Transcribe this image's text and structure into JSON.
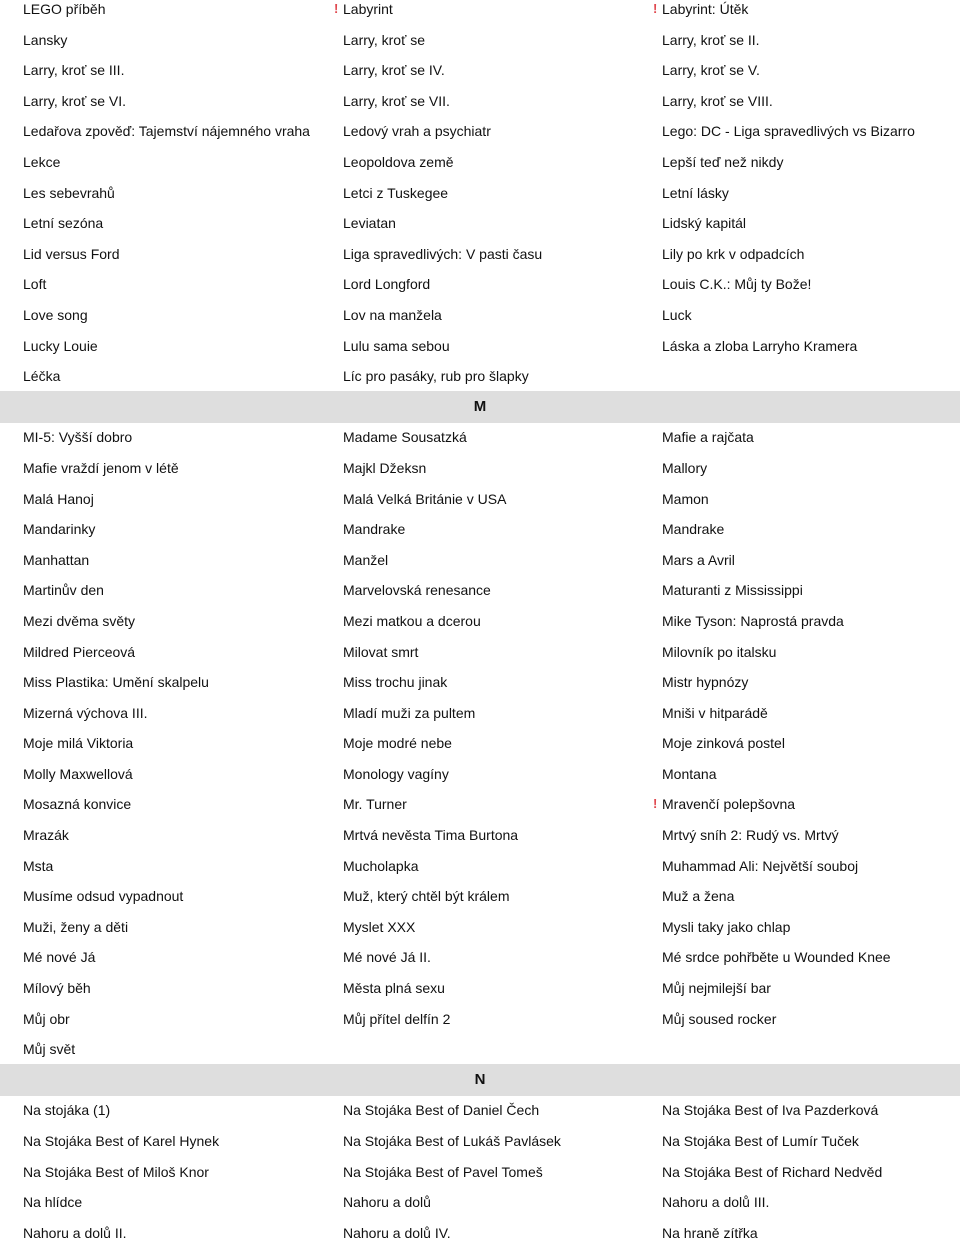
{
  "accent_color": "#e0484f",
  "sections": [
    {
      "letter": "",
      "rows": [
        [
          {
            "t": "LEGO příběh"
          },
          {
            "t": "Labyrint",
            "warn": true
          },
          {
            "t": "Labyrint: Útěk",
            "warn": true
          }
        ],
        [
          {
            "t": "Lansky"
          },
          {
            "t": "Larry, kroť se"
          },
          {
            "t": "Larry, kroť se II."
          }
        ],
        [
          {
            "t": "Larry, kroť se III."
          },
          {
            "t": "Larry, kroť se IV."
          },
          {
            "t": "Larry, kroť se V."
          }
        ],
        [
          {
            "t": "Larry, kroť se VI."
          },
          {
            "t": "Larry, kroť se VII."
          },
          {
            "t": "Larry, kroť se VIII."
          }
        ],
        [
          {
            "t": "Ledařova zpověď: Tajemství nájemného vraha"
          },
          {
            "t": "Ledový vrah a psychiatr"
          },
          {
            "t": "Lego: DC - Liga spravedlivých vs Bizarro"
          }
        ],
        [
          {
            "t": "Lekce"
          },
          {
            "t": "Leopoldova země"
          },
          {
            "t": "Lepší teď než nikdy"
          }
        ],
        [
          {
            "t": "Les sebevrahů"
          },
          {
            "t": "Letci z Tuskegee"
          },
          {
            "t": "Letní lásky"
          }
        ],
        [
          {
            "t": "Letní sezóna"
          },
          {
            "t": "Leviatan"
          },
          {
            "t": "Lidský kapitál"
          }
        ],
        [
          {
            "t": "Lid versus Ford"
          },
          {
            "t": "Liga spravedlivých: V pasti času"
          },
          {
            "t": "Lily po krk v odpadcích"
          }
        ],
        [
          {
            "t": "Loft"
          },
          {
            "t": "Lord Longford"
          },
          {
            "t": "Louis C.K.: Můj ty Bože!"
          }
        ],
        [
          {
            "t": "Love song"
          },
          {
            "t": "Lov na manžela"
          },
          {
            "t": "Luck"
          }
        ],
        [
          {
            "t": "Lucky Louie"
          },
          {
            "t": "Lulu sama sebou"
          },
          {
            "t": "Láska a zloba Larryho Kramera"
          }
        ],
        [
          {
            "t": "Léčka"
          },
          {
            "t": "Líc pro pasáky, rub pro šlapky"
          }
        ]
      ]
    },
    {
      "letter": "M",
      "rows": [
        [
          {
            "t": "MI-5: Vyšší dobro"
          },
          {
            "t": "Madame Sousatzká"
          },
          {
            "t": "Mafie a rajčata"
          }
        ],
        [
          {
            "t": "Mafie vraždí jenom v létě"
          },
          {
            "t": "Majkl Džeksn"
          },
          {
            "t": "Mallory"
          }
        ],
        [
          {
            "t": "Malá Hanoj"
          },
          {
            "t": "Malá Velká Británie v USA"
          },
          {
            "t": "Mamon"
          }
        ],
        [
          {
            "t": "Mandarinky"
          },
          {
            "t": "Mandrake"
          },
          {
            "t": "Mandrake"
          }
        ],
        [
          {
            "t": "Manhattan"
          },
          {
            "t": "Manžel"
          },
          {
            "t": "Mars a Avril"
          }
        ],
        [
          {
            "t": "Martinův den"
          },
          {
            "t": "Marvelovská renesance"
          },
          {
            "t": "Maturanti z Mississippi"
          }
        ],
        [
          {
            "t": "Mezi dvěma světy"
          },
          {
            "t": "Mezi matkou a dcerou"
          },
          {
            "t": "Mike Tyson: Naprostá pravda"
          }
        ],
        [
          {
            "t": "Mildred Pierceová"
          },
          {
            "t": "Milovat smrt"
          },
          {
            "t": "Milovník po italsku"
          }
        ],
        [
          {
            "t": "Miss Plastika: Umění skalpelu"
          },
          {
            "t": "Miss trochu jinak"
          },
          {
            "t": "Mistr hypnózy"
          }
        ],
        [
          {
            "t": "Mizerná výchova III."
          },
          {
            "t": "Mladí muži za pultem"
          },
          {
            "t": "Mniši v hitparádě"
          }
        ],
        [
          {
            "t": "Moje milá Viktoria"
          },
          {
            "t": "Moje modré nebe"
          },
          {
            "t": "Moje zinková postel"
          }
        ],
        [
          {
            "t": "Molly Maxwellová"
          },
          {
            "t": "Monology vagíny"
          },
          {
            "t": "Montana"
          }
        ],
        [
          {
            "t": "Mosazná konvice"
          },
          {
            "t": "Mr. Turner"
          },
          {
            "t": "Mravenčí polepšovna",
            "warn": true
          }
        ],
        [
          {
            "t": "Mrazák"
          },
          {
            "t": "Mrtvá nevěsta Tima Burtona"
          },
          {
            "t": "Mrtvý sníh 2: Rudý vs. Mrtvý"
          }
        ],
        [
          {
            "t": "Msta"
          },
          {
            "t": "Mucholapka"
          },
          {
            "t": "Muhammad Ali: Největší souboj"
          }
        ],
        [
          {
            "t": "Musíme odsud vypadnout"
          },
          {
            "t": "Muž, který chtěl být králem"
          },
          {
            "t": "Muž a žena"
          }
        ],
        [
          {
            "t": "Muži, ženy a děti"
          },
          {
            "t": "Myslet XXX"
          },
          {
            "t": "Mysli taky jako chlap"
          }
        ],
        [
          {
            "t": "Mé nové Já"
          },
          {
            "t": "Mé nové Já II."
          },
          {
            "t": "Mé srdce pohřběte u Wounded Knee"
          }
        ],
        [
          {
            "t": "Mílový běh"
          },
          {
            "t": "Města plná sexu"
          },
          {
            "t": "Můj nejmilejší bar"
          }
        ],
        [
          {
            "t": "Můj obr"
          },
          {
            "t": "Můj přítel delfín 2"
          },
          {
            "t": "Můj soused rocker"
          }
        ],
        [
          {
            "t": "Můj svět"
          }
        ]
      ]
    },
    {
      "letter": "N",
      "rows": [
        [
          {
            "t": "Na stojáka (1)"
          },
          {
            "t": "Na Stojáka Best of Daniel Čech"
          },
          {
            "t": "Na Stojáka Best of Iva Pazderková"
          }
        ],
        [
          {
            "t": "Na Stojáka Best of Karel Hynek"
          },
          {
            "t": "Na Stojáka Best of Lukáš Pavlásek"
          },
          {
            "t": "Na Stojáka Best of Lumír Tuček"
          }
        ],
        [
          {
            "t": "Na Stojáka Best of Miloš Knor"
          },
          {
            "t": "Na Stojáka Best of Pavel Tomeš"
          },
          {
            "t": "Na Stojáka Best of Richard Nedvěd"
          }
        ],
        [
          {
            "t": "Na hlídce"
          },
          {
            "t": "Nahoru a dolů"
          },
          {
            "t": "Nahoru a dolů III."
          }
        ],
        [
          {
            "t": "Nahoru a dolů II."
          },
          {
            "t": "Nahoru a dolů IV."
          },
          {
            "t": "Na hraně zítřka"
          }
        ]
      ]
    }
  ]
}
